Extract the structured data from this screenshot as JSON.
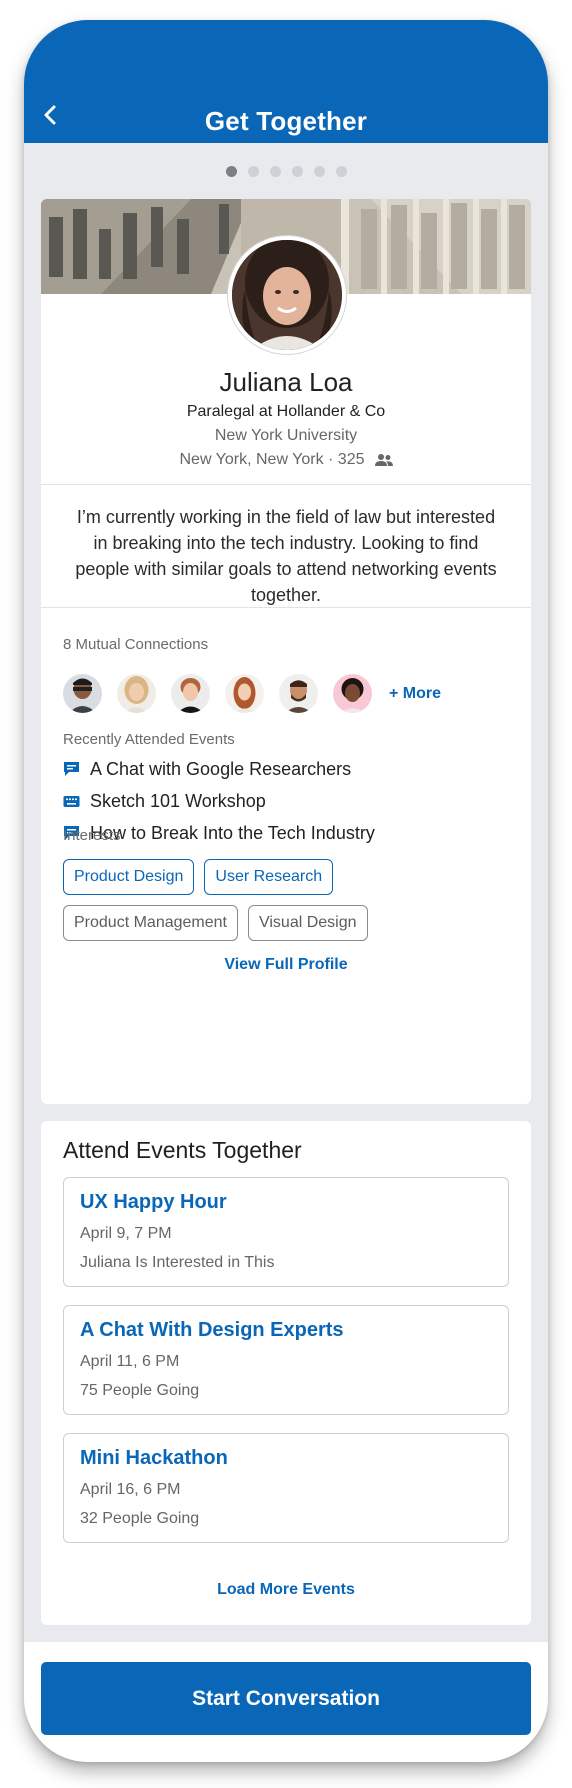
{
  "header": {
    "title": "Get Together"
  },
  "pager": {
    "page": 1,
    "total": 6
  },
  "profile": {
    "name": "Juliana Loa",
    "headline": "Paralegal at Hollander & Co",
    "school": "New York University",
    "location": "New York, New York · 325",
    "bio": "I’m currently working in the field of law but interested in breaking into the tech industry. Looking to find people with similar goals to attend networking events together.",
    "mutual_label": "8 Mutual Connections",
    "more_label": "+ More",
    "recent_label": "Recently Attended Events",
    "recent_events": [
      {
        "label": "A Chat with Google Researchers",
        "icon": "chat-icon"
      },
      {
        "label": "Sketch 101 Workshop",
        "icon": "keyboard-icon"
      },
      {
        "label": "How to Break Into the Tech Industry",
        "icon": "chat-icon"
      }
    ],
    "interests_label": "Interests",
    "interests": [
      {
        "label": "Product Design",
        "style": "highlighted"
      },
      {
        "label": "User Research",
        "style": "highlighted"
      },
      {
        "label": "Product Management",
        "style": "default"
      },
      {
        "label": "Visual Design",
        "style": "default"
      }
    ],
    "view_profile": "View Full Profile"
  },
  "events": {
    "title": "Attend Events Together",
    "items": [
      {
        "name": "UX Happy Hour",
        "date": "April 9, 7 PM",
        "status": "Juliana Is Interested in This"
      },
      {
        "name": "A Chat With Design Experts",
        "date": "April 11, 6 PM",
        "status": "75 People Going"
      },
      {
        "name": "Mini Hackathon",
        "date": "April 16, 6 PM",
        "status": "32 People Going"
      }
    ],
    "load_more": "Load More Events"
  },
  "cta": {
    "label": "Start Conversation"
  },
  "colors": {
    "brand": "#0a66b7",
    "background": "#e8eaed"
  }
}
